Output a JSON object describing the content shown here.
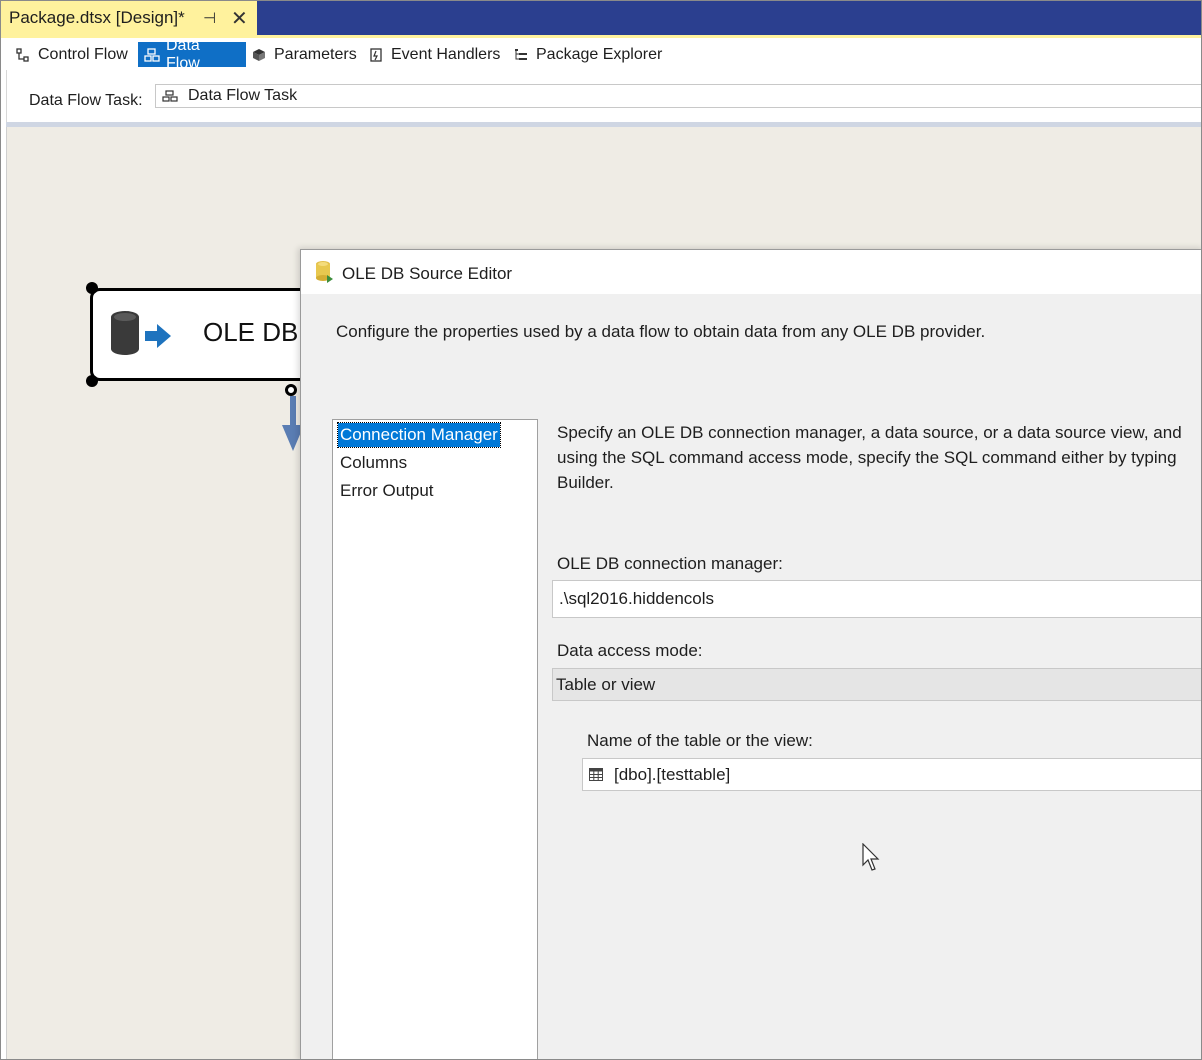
{
  "document_tab": {
    "title": "Package.dtsx [Design]*",
    "pin_glyph": "⊣",
    "close_glyph": "✕"
  },
  "designer_tabs": [
    {
      "label": "Control Flow",
      "icon": "control-flow-icon",
      "active": false
    },
    {
      "label": "Data Flow",
      "icon": "data-flow-icon",
      "active": true
    },
    {
      "label": "Parameters",
      "icon": "parameters-icon",
      "active": false
    },
    {
      "label": "Event Handlers",
      "icon": "event-handlers-icon",
      "active": false
    },
    {
      "label": "Package Explorer",
      "icon": "package-explorer-icon",
      "active": false
    }
  ],
  "task_bar": {
    "label": "Data Flow Task:",
    "selected_task": "Data Flow Task"
  },
  "canvas": {
    "component_label": "OLE DB S"
  },
  "dialog": {
    "title": "OLE DB Source Editor",
    "description": "Configure the properties used by a data flow to obtain data from any OLE DB provider.",
    "nav_items": [
      "Connection Manager",
      "Columns",
      "Error Output"
    ],
    "selected_nav": "Connection Manager",
    "info_text": "Specify an OLE DB connection manager, a data source, or a data source view, and\nusing the SQL command access mode, specify the SQL command either by typing\nBuilder.",
    "connection_manager_label": "OLE DB connection manager:",
    "connection_manager_value": ".\\sql2016.hiddencols",
    "access_mode_label": "Data access mode:",
    "access_mode_value": "Table or view",
    "table_label": "Name of the table or the view:",
    "table_value": "[dbo].[testtable]"
  },
  "colors": {
    "accent": "#0f6fc6",
    "doc_tab": "#fff29d",
    "tab_strip": "#2b3f8f",
    "canvas": "#efece5",
    "selection": "#0078d7"
  }
}
